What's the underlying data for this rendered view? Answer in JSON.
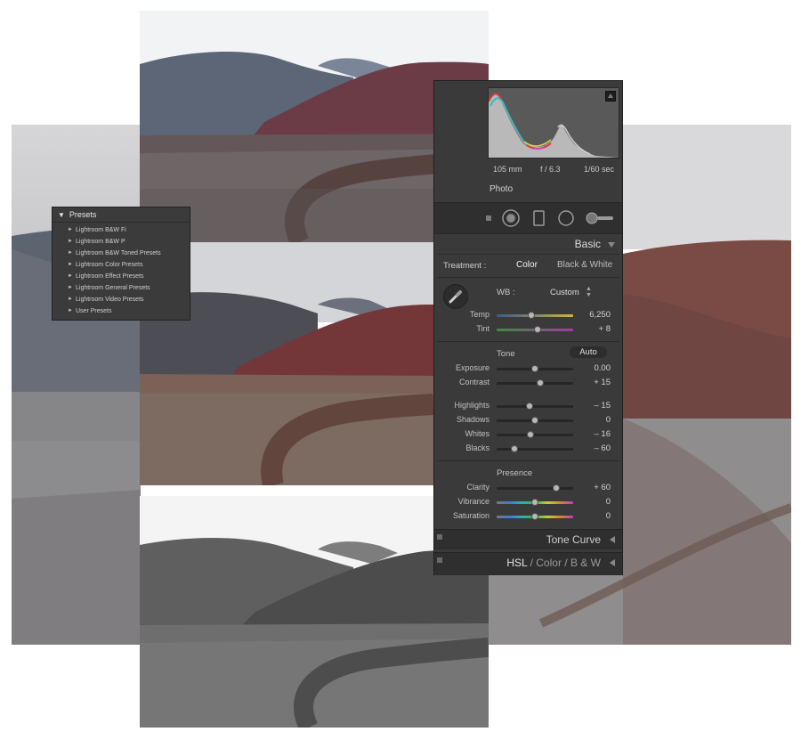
{
  "presets": {
    "title": "Presets",
    "items": [
      "Lightroom B&W Fi",
      "Lightroom B&W P",
      "Lightroom B&W Toned Presets",
      "Lightroom Color Presets",
      "Lightroom Effect Presets",
      "Lightroom General Presets",
      "Lightroom Video Presets",
      "User Presets"
    ]
  },
  "histogram": {
    "focal": "105 mm",
    "aperture": "f / 6.3",
    "shutter": "1/60 sec",
    "label": "Photo"
  },
  "basic": {
    "title": "Basic",
    "treatment_label": "Treatment :",
    "treatment_color": "Color",
    "treatment_bw": "Black & White",
    "wb_label": "WB :",
    "wb_value": "Custom",
    "temp": {
      "label": "Temp",
      "value": "6,250",
      "level": 0.45
    },
    "tint": {
      "label": "Tint",
      "value": "+ 8",
      "level": 0.53
    },
    "tone_title": "Tone",
    "auto": "Auto",
    "exposure": {
      "label": "Exposure",
      "value": "0.00",
      "level": 0.5
    },
    "contrast": {
      "label": "Contrast",
      "value": "+ 15",
      "level": 0.57
    },
    "highlights": {
      "label": "Highlights",
      "value": "– 15",
      "level": 0.43
    },
    "shadows": {
      "label": "Shadows",
      "value": "0",
      "level": 0.5
    },
    "whites": {
      "label": "Whites",
      "value": "– 16",
      "level": 0.44
    },
    "blacks": {
      "label": "Blacks",
      "value": "– 60",
      "level": 0.23
    },
    "presence_title": "Presence",
    "clarity": {
      "label": "Clarity",
      "value": "+ 60",
      "level": 0.78
    },
    "vibrance": {
      "label": "Vibrance",
      "value": "0",
      "level": 0.5
    },
    "saturation": {
      "label": "Saturation",
      "value": "0",
      "level": 0.5
    }
  },
  "tone_curve": "Tone Curve",
  "hsl": {
    "hsl": "HSL",
    "sep1": "/",
    "color": "Color",
    "sep2": "/",
    "bw": "B & W"
  },
  "colors": {
    "panel_bg": "#3a3a3a",
    "temp_gradient_start": "#3b5a8a",
    "temp_gradient_end": "#c9b24a",
    "tint_gradient_start": "#3f8a3f",
    "tint_gradient_end": "#a23aa2"
  },
  "icons": [
    "eyedropper-icon",
    "crop-icon",
    "spot-removal-icon",
    "red-eye-icon",
    "graduated-filter-icon",
    "radial-filter-icon",
    "adjustment-brush-icon",
    "histogram-clip-icon"
  ]
}
